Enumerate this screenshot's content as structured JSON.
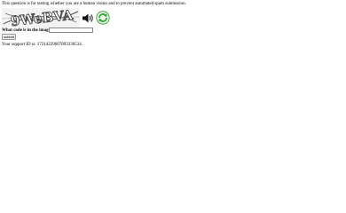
{
  "intro_text": "This question is for testing whether you are a human visitor and to prevent automated spam submission.",
  "captcha": {
    "image_text": "9WeBVA",
    "audio_icon": "speaker-icon",
    "refresh_icon": "refresh-icon"
  },
  "form": {
    "question_label": "What code is in the image?",
    "answer_value": "",
    "submit_label": "submit"
  },
  "support_text": "Your support ID is: 17214229607893330534.",
  "colors": {
    "refresh_green": "#3aa53a",
    "captcha_ink": "#4a4a4a"
  }
}
